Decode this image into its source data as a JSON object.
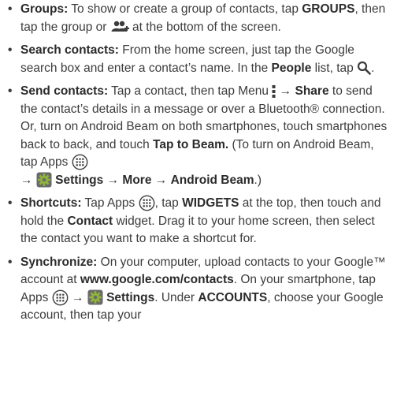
{
  "items": [
    {
      "label": "Groups:",
      "p1": " To show or create a group of contacts, tap ",
      "b1": "GROUPS",
      "p2": ", then tap the group or ",
      "icon1": "group-icon",
      "p3": " at the bottom of the screen."
    },
    {
      "label": "Search contacts:",
      "p1": " From the home screen, just tap the Google search box and enter a contact’s name. In the ",
      "b1": "People",
      "p2": " list, tap ",
      "icon1": "search-icon",
      "p3": "."
    },
    {
      "label": "Send contacts:",
      "p1": " Tap a contact, then tap Menu ",
      "icon1": "menu-icon",
      "p2": " → ",
      "b1": "Share",
      "p3": " to send the contact’s details in a message or over a Bluetooth® connection. Or, turn on Android Beam on both smartphones, touch smartphones back to back, and touch ",
      "b2": "Tap to Beam.",
      "p4": " (To turn on Android Beam, tap Apps ",
      "icon2": "apps-icon",
      "p5": " → ",
      "icon3": "settings-gear-icon",
      "b3": "Settings",
      "p6": " → ",
      "b4": "More",
      "p7": " → ",
      "b5": "Android Beam",
      "p8": ".)"
    },
    {
      "label": "Shortcuts:",
      "p1": " Tap Apps ",
      "icon1": "apps-icon",
      "p2": ", tap ",
      "b1": "WIDGETS",
      "p3": " at the top, then touch and hold the ",
      "b2": "Contact",
      "p4": " widget. Drag it to your home screen, then select the contact you want to make a shortcut for."
    },
    {
      "label": "Synchronize:",
      "p1": " On your computer, upload contacts to your Google™ account at ",
      "b1": "www.google.com/contacts",
      "p2": ". On your smartphone, tap Apps ",
      "icon1": "apps-icon",
      "p3": " → ",
      "icon2": "settings-gear-icon",
      "b2": "Settings",
      "p4": ". Under ",
      "b3": "ACCOUNTS",
      "p5": ", choose your Google account, then tap your"
    }
  ],
  "colors": {
    "text": "#3c3c3c",
    "gear": "#8fb53a"
  }
}
